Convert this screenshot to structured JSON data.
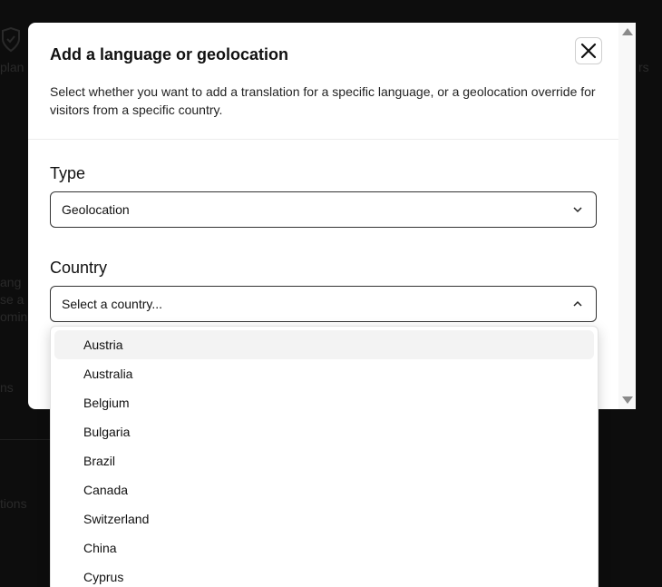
{
  "background": {
    "fragments": [
      "plan",
      "rs",
      "ang",
      "se a",
      "omin",
      "ns",
      "tions"
    ]
  },
  "modal": {
    "title": "Add a language or geolocation",
    "description": "Select whether you want to add a translation for a specific language, or a geolocation override for visitors from a specific country.",
    "close_icon": "close-icon",
    "type_field": {
      "label": "Type",
      "value": "Geolocation"
    },
    "country_field": {
      "label": "Country",
      "placeholder": "Select a country..."
    }
  },
  "country_options": [
    "Austria",
    "Australia",
    "Belgium",
    "Bulgaria",
    "Brazil",
    "Canada",
    "Switzerland",
    "China",
    "Cyprus"
  ],
  "highlighted_option": "Austria",
  "colors": {
    "overlay": "#0d0d0d",
    "modal_bg": "#ffffff",
    "highlight_bg": "#f3f3f3",
    "border": "#333333"
  }
}
